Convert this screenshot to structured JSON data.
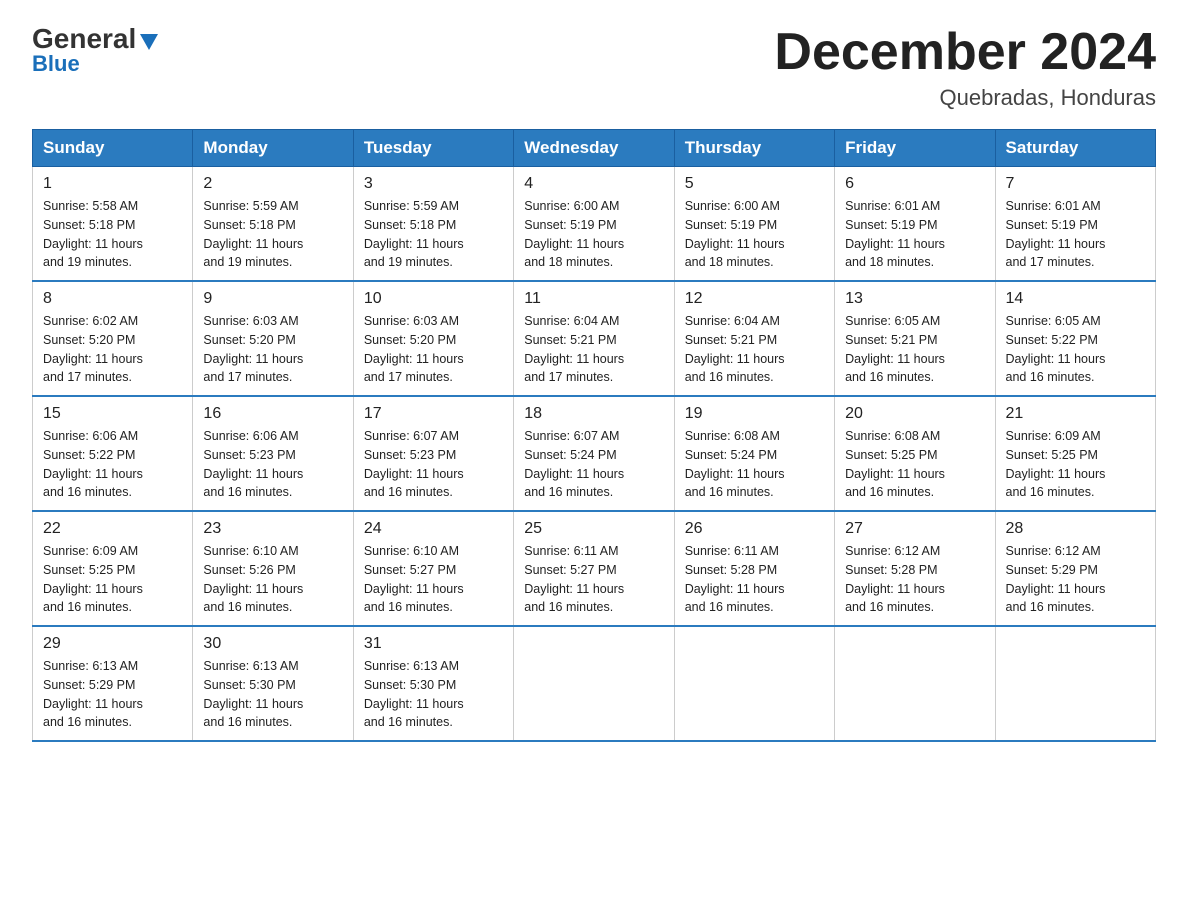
{
  "logo": {
    "general": "General",
    "blue": "Blue",
    "triangle": "▼"
  },
  "title": "December 2024",
  "location": "Quebradas, Honduras",
  "days_of_week": [
    "Sunday",
    "Monday",
    "Tuesday",
    "Wednesday",
    "Thursday",
    "Friday",
    "Saturday"
  ],
  "weeks": [
    [
      {
        "day": "1",
        "sunrise": "5:58 AM",
        "sunset": "5:18 PM",
        "daylight": "11 hours and 19 minutes."
      },
      {
        "day": "2",
        "sunrise": "5:59 AM",
        "sunset": "5:18 PM",
        "daylight": "11 hours and 19 minutes."
      },
      {
        "day": "3",
        "sunrise": "5:59 AM",
        "sunset": "5:18 PM",
        "daylight": "11 hours and 19 minutes."
      },
      {
        "day": "4",
        "sunrise": "6:00 AM",
        "sunset": "5:19 PM",
        "daylight": "11 hours and 18 minutes."
      },
      {
        "day": "5",
        "sunrise": "6:00 AM",
        "sunset": "5:19 PM",
        "daylight": "11 hours and 18 minutes."
      },
      {
        "day": "6",
        "sunrise": "6:01 AM",
        "sunset": "5:19 PM",
        "daylight": "11 hours and 18 minutes."
      },
      {
        "day": "7",
        "sunrise": "6:01 AM",
        "sunset": "5:19 PM",
        "daylight": "11 hours and 17 minutes."
      }
    ],
    [
      {
        "day": "8",
        "sunrise": "6:02 AM",
        "sunset": "5:20 PM",
        "daylight": "11 hours and 17 minutes."
      },
      {
        "day": "9",
        "sunrise": "6:03 AM",
        "sunset": "5:20 PM",
        "daylight": "11 hours and 17 minutes."
      },
      {
        "day": "10",
        "sunrise": "6:03 AM",
        "sunset": "5:20 PM",
        "daylight": "11 hours and 17 minutes."
      },
      {
        "day": "11",
        "sunrise": "6:04 AM",
        "sunset": "5:21 PM",
        "daylight": "11 hours and 17 minutes."
      },
      {
        "day": "12",
        "sunrise": "6:04 AM",
        "sunset": "5:21 PM",
        "daylight": "11 hours and 16 minutes."
      },
      {
        "day": "13",
        "sunrise": "6:05 AM",
        "sunset": "5:21 PM",
        "daylight": "11 hours and 16 minutes."
      },
      {
        "day": "14",
        "sunrise": "6:05 AM",
        "sunset": "5:22 PM",
        "daylight": "11 hours and 16 minutes."
      }
    ],
    [
      {
        "day": "15",
        "sunrise": "6:06 AM",
        "sunset": "5:22 PM",
        "daylight": "11 hours and 16 minutes."
      },
      {
        "day": "16",
        "sunrise": "6:06 AM",
        "sunset": "5:23 PM",
        "daylight": "11 hours and 16 minutes."
      },
      {
        "day": "17",
        "sunrise": "6:07 AM",
        "sunset": "5:23 PM",
        "daylight": "11 hours and 16 minutes."
      },
      {
        "day": "18",
        "sunrise": "6:07 AM",
        "sunset": "5:24 PM",
        "daylight": "11 hours and 16 minutes."
      },
      {
        "day": "19",
        "sunrise": "6:08 AM",
        "sunset": "5:24 PM",
        "daylight": "11 hours and 16 minutes."
      },
      {
        "day": "20",
        "sunrise": "6:08 AM",
        "sunset": "5:25 PM",
        "daylight": "11 hours and 16 minutes."
      },
      {
        "day": "21",
        "sunrise": "6:09 AM",
        "sunset": "5:25 PM",
        "daylight": "11 hours and 16 minutes."
      }
    ],
    [
      {
        "day": "22",
        "sunrise": "6:09 AM",
        "sunset": "5:25 PM",
        "daylight": "11 hours and 16 minutes."
      },
      {
        "day": "23",
        "sunrise": "6:10 AM",
        "sunset": "5:26 PM",
        "daylight": "11 hours and 16 minutes."
      },
      {
        "day": "24",
        "sunrise": "6:10 AM",
        "sunset": "5:27 PM",
        "daylight": "11 hours and 16 minutes."
      },
      {
        "day": "25",
        "sunrise": "6:11 AM",
        "sunset": "5:27 PM",
        "daylight": "11 hours and 16 minutes."
      },
      {
        "day": "26",
        "sunrise": "6:11 AM",
        "sunset": "5:28 PM",
        "daylight": "11 hours and 16 minutes."
      },
      {
        "day": "27",
        "sunrise": "6:12 AM",
        "sunset": "5:28 PM",
        "daylight": "11 hours and 16 minutes."
      },
      {
        "day": "28",
        "sunrise": "6:12 AM",
        "sunset": "5:29 PM",
        "daylight": "11 hours and 16 minutes."
      }
    ],
    [
      {
        "day": "29",
        "sunrise": "6:13 AM",
        "sunset": "5:29 PM",
        "daylight": "11 hours and 16 minutes."
      },
      {
        "day": "30",
        "sunrise": "6:13 AM",
        "sunset": "5:30 PM",
        "daylight": "11 hours and 16 minutes."
      },
      {
        "day": "31",
        "sunrise": "6:13 AM",
        "sunset": "5:30 PM",
        "daylight": "11 hours and 16 minutes."
      },
      null,
      null,
      null,
      null
    ]
  ],
  "labels": {
    "sunrise": "Sunrise:",
    "sunset": "Sunset:",
    "daylight": "Daylight:"
  }
}
